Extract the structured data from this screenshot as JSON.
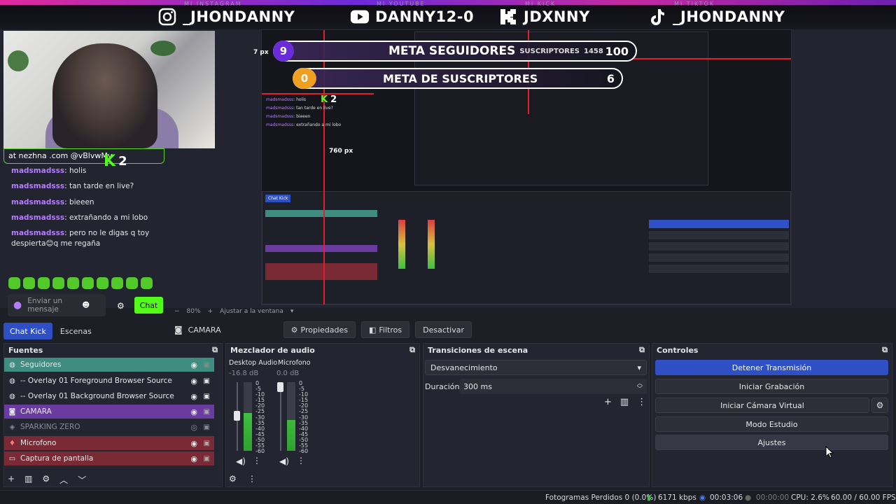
{
  "banner": {
    "items": [
      {
        "icon": "instagram-icon",
        "caption": "MI INSTAGRAM",
        "handle": "_JHONDANNY"
      },
      {
        "icon": "youtube-icon",
        "caption": "MI YOUTUBE",
        "handle": "DANNY12-0"
      },
      {
        "icon": "kick-icon",
        "caption": "MI KICK",
        "handle": "JDXNNY"
      },
      {
        "icon": "tiktok-icon",
        "caption": "MI TIKTOK",
        "handle": "_JHONDANNY"
      }
    ]
  },
  "overlay": {
    "chat_header": "at nezhna .com @vBlvwMv",
    "kick_viewers": "2",
    "goals": [
      {
        "number": "9",
        "title": "META SEGUIDORES",
        "subtitle": "SUSCRIPTORES",
        "count": "1458",
        "target": "100"
      },
      {
        "number": "0",
        "title": "META DE SUSCRIPTORES",
        "target": "6"
      }
    ],
    "px_labels": {
      "left": "7 px",
      "bottom": "760 px"
    },
    "chat": [
      {
        "user": "madsmadsss",
        "msg": ": holis"
      },
      {
        "user": "madsmadsss",
        "msg": ": tan tarde en live?"
      },
      {
        "user": "madsmadsss",
        "msg": ": bieeen"
      },
      {
        "user": "madsmadsss",
        "msg": ": extrañando a mi lobo"
      },
      {
        "user": "madsmadsss",
        "msg": ": pero no le digas q toy"
      },
      {
        "user": "",
        "msg": "despierta😊q me regaña"
      }
    ],
    "chat_input_placeholder": "Enviar un mensaje",
    "chat_button": "Chat"
  },
  "preview_bar": {
    "zoom": "80%",
    "fit": "Ajustar a la ventana"
  },
  "tabs": [
    "Chat Kick",
    "Escenas"
  ],
  "source_toolbar": {
    "source": "CAMARA",
    "properties": "Propiedades",
    "filters": "Filtros",
    "deactivate": "Desactivar"
  },
  "sources": {
    "title": "Fuentes",
    "items": [
      {
        "name": "Seguidores",
        "icon": "globe-icon",
        "color": "#3f8c80"
      },
      {
        "name": "-- Overlay 01  Foreground Browser Source",
        "icon": "globe-icon",
        "color": ""
      },
      {
        "name": "-- Overlay 01  Background Browser Source",
        "icon": "globe-icon",
        "color": ""
      },
      {
        "name": "CAMARA",
        "icon": "camera-icon",
        "color": "#6a3ca0"
      },
      {
        "name": "SPARKING ZERO",
        "icon": "gamepad-icon",
        "color": ""
      },
      {
        "name": "Microfono",
        "icon": "mic-icon",
        "color": "#7a2a34"
      },
      {
        "name": "Captura de pantalla",
        "icon": "monitor-icon",
        "color": "#7a2a34"
      }
    ]
  },
  "mixer": {
    "title": "Mezclador de audio",
    "channels": [
      {
        "name": "Desktop Audio",
        "db": "-16.8 dB",
        "level": 0.55
      },
      {
        "name": "Microfono",
        "db": "0.0 dB",
        "level": 0.45
      }
    ],
    "scale": [
      "0",
      "-5",
      "-10",
      "-15",
      "-20",
      "-25",
      "-30",
      "-35",
      "-40",
      "-45",
      "-50",
      "-55",
      "-60"
    ]
  },
  "transitions": {
    "title": "Transiciones de escena",
    "selected": "Desvanecimiento",
    "duration_label": "Duración",
    "duration": "300 ms"
  },
  "controls": {
    "title": "Controles",
    "buttons": [
      "Detener Transmisión",
      "Iniciar Grabación",
      "Iniciar Cámara Virtual",
      "Modo Estudio",
      "Ajustes"
    ],
    "accent": "#2f4fc4"
  },
  "status": {
    "dropped": "Fotogramas Perdidos 0 (0.0%)",
    "bitrate": "6171 kbps",
    "stream_time": "00:03:06",
    "rec_time": "00:00:00",
    "cpu": "CPU: 2.6%",
    "fps": "60.00 / 60.00 FPS"
  }
}
